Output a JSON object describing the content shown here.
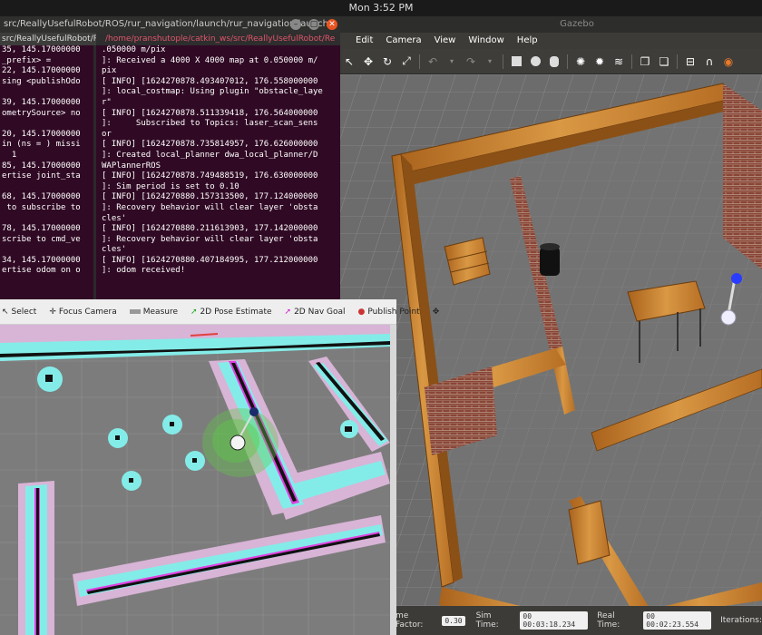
{
  "system": {
    "clock": "Mon  3:52 PM"
  },
  "gazebo": {
    "title": "Gazebo",
    "menu": [
      "Edit",
      "Camera",
      "View",
      "Window",
      "Help"
    ],
    "status": {
      "factor_label": "me Factor:",
      "factor_value": "0.30",
      "sim_label": "Sim Time:",
      "sim_value": "00 00:03:18.234",
      "real_label": "Real Time:",
      "real_value": "00 00:02:23.554",
      "iter_label": "Iterations:"
    }
  },
  "terminal": {
    "title": "src/ReallyUsefulRobot/ROS/rur_navigation/launch/rur_navigation.launch",
    "tab_left": "src/ReallyUsefulRobot/R",
    "tab_right": "/home/pranshutople/catkin_ws/src/ReallyUsefulRobot/Re",
    "left_lines": [
      "35, 145.17000000",
      "_prefix> =",
      "22, 145.17000000",
      "sing <publishOdo",
      "",
      "39, 145.17000000",
      "ometrySource> no",
      "",
      "20, 145.17000000",
      "in (ns = ) missi",
      "  1",
      "85, 145.17000000",
      "ertise joint_sta",
      "",
      "68, 145.17000000",
      " to subscribe to",
      "",
      "78, 145.17000000",
      "scribe to cmd_ve",
      "",
      "34, 145.17000000",
      "ertise odom on o"
    ],
    "right_lines": [
      ".050000 m/pix",
      "]: Received a 4000 X 4000 map at 0.050000 m/",
      "pix",
      "[ INFO] [1624270878.493407012, 176.558000000",
      "]: local_costmap: Using plugin \"obstacle_laye",
      "r\"",
      "[ INFO] [1624270878.511339418, 176.564000000",
      "]:     Subscribed to Topics: laser_scan_sens",
      "or",
      "[ INFO] [1624270878.735814957, 176.626000000",
      "]: Created local_planner dwa_local_planner/D",
      "WAPlannerROS",
      "[ INFO] [1624270878.749488519, 176.630000000",
      "]: Sim period is set to 0.10",
      "[ INFO] [1624270880.157313500, 177.124000000",
      "]: Recovery behavior will clear layer 'obsta",
      "cles'",
      "[ INFO] [1624270880.211613903, 177.142000000",
      "]: Recovery behavior will clear layer 'obsta",
      "cles'",
      "[ INFO] [1624270880.407184995, 177.212000000",
      "]: odom received!"
    ]
  },
  "rviz": {
    "tools": [
      {
        "label": "Select",
        "icon": "cursor-icon"
      },
      {
        "label": "Focus Camera",
        "icon": "focus-icon"
      },
      {
        "label": "Measure",
        "icon": "ruler-icon"
      },
      {
        "label": "2D Pose Estimate",
        "icon": "green-arrow-icon"
      },
      {
        "label": "2D Nav Goal",
        "icon": "magenta-arrow-icon"
      },
      {
        "label": "Publish Point",
        "icon": "pin-icon"
      }
    ]
  },
  "colors": {
    "terminal_bg": "#300a24",
    "error_red": "#e0556a",
    "costmap_cyan": "#7fe8e6",
    "costmap_magenta": "#e040e0",
    "inflation_pink": "#d7a8d0",
    "gazebo_floor": "#6a6a6a",
    "wood": "#c8862e",
    "brick": "#8a4536"
  }
}
